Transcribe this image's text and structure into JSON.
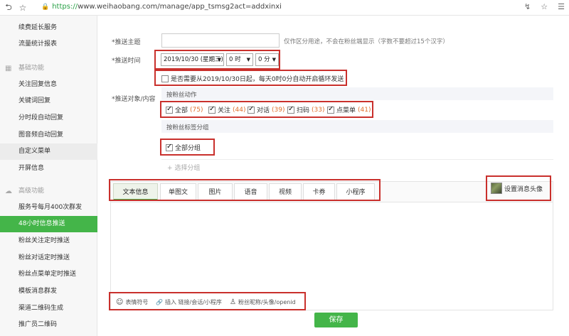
{
  "browser": {
    "url_scheme": "https://",
    "url_rest": "www.weihaobang.com/manage/app_tsmsg2act=addxinxi",
    "back_glyph": "⮌",
    "star_glyph": "☆",
    "right_icons": [
      "↯",
      "☆",
      "☰"
    ]
  },
  "sidebar": {
    "items": [
      {
        "label": "续费延长服务",
        "type": "item"
      },
      {
        "label": "流量统计报表",
        "type": "item"
      },
      {
        "label": "基础功能",
        "type": "group"
      },
      {
        "label": "关注回复信息",
        "type": "item"
      },
      {
        "label": "关键词回复",
        "type": "item"
      },
      {
        "label": "分时段自动回复",
        "type": "item"
      },
      {
        "label": "图音频自动回复",
        "type": "item"
      },
      {
        "label": "自定义菜单",
        "type": "item",
        "state": "hover"
      },
      {
        "label": "开屏信息",
        "type": "item"
      },
      {
        "label": "高级功能",
        "type": "group"
      },
      {
        "label": "服务号每月400次群发",
        "type": "item"
      },
      {
        "label": "48小时信息推送",
        "type": "item",
        "state": "active"
      },
      {
        "label": "粉丝关注定时推送",
        "type": "item"
      },
      {
        "label": "粉丝对话定时推送",
        "type": "item"
      },
      {
        "label": "粉丝点菜单定时推送",
        "type": "item"
      },
      {
        "label": "模板消息群发",
        "type": "item"
      },
      {
        "label": "渠道二维码生成",
        "type": "item"
      },
      {
        "label": "推广员二维码",
        "type": "item"
      }
    ]
  },
  "form": {
    "subject": {
      "label": "*推送主题",
      "value": "",
      "hint": "仅作区分用途，不会在粉丝端显示（字数不要超过15个汉字）"
    },
    "time": {
      "label": "*推送时间",
      "date": "2019/10/30 (星期三)",
      "hour": "0 时",
      "minute": "0 分"
    },
    "repeat": {
      "checked": false,
      "label": "是否需要从2019/10/30日起，每天0时0分自动开启循环发送"
    },
    "target": {
      "label": "*推送对象/内容",
      "by_action_title": "按粉丝动作",
      "actions": [
        {
          "name": "全部",
          "count": "(75)",
          "checked": true
        },
        {
          "name": "关注",
          "count": "(44)",
          "checked": true
        },
        {
          "name": "对话",
          "count": "(39)",
          "checked": true
        },
        {
          "name": "扫码",
          "count": "(33)",
          "checked": true
        },
        {
          "name": "点菜单",
          "count": "(41)",
          "checked": true
        }
      ],
      "by_tag_title": "按粉丝标签分组",
      "all_groups": {
        "label": "全部分组",
        "checked": true
      },
      "select_group_link": "+ 选择分组"
    },
    "content_tabs": [
      "文本信息",
      "单图文",
      "图片",
      "语音",
      "视频",
      "卡券",
      "小程序"
    ],
    "active_tab": "文本信息",
    "set_avatar": "设置消息头像",
    "toolbar": [
      {
        "icon": "☺",
        "label": "表情符号"
      },
      {
        "icon": "🔗",
        "label": "插入 链接/会话/小程序"
      },
      {
        "icon": "♙",
        "label": "粉丝昵称/头像/openid"
      }
    ],
    "save_label": "保存"
  },
  "colors": {
    "accent_green": "#44b549",
    "annotation_red": "#c9302c",
    "count_orange": "#e06e2b"
  }
}
